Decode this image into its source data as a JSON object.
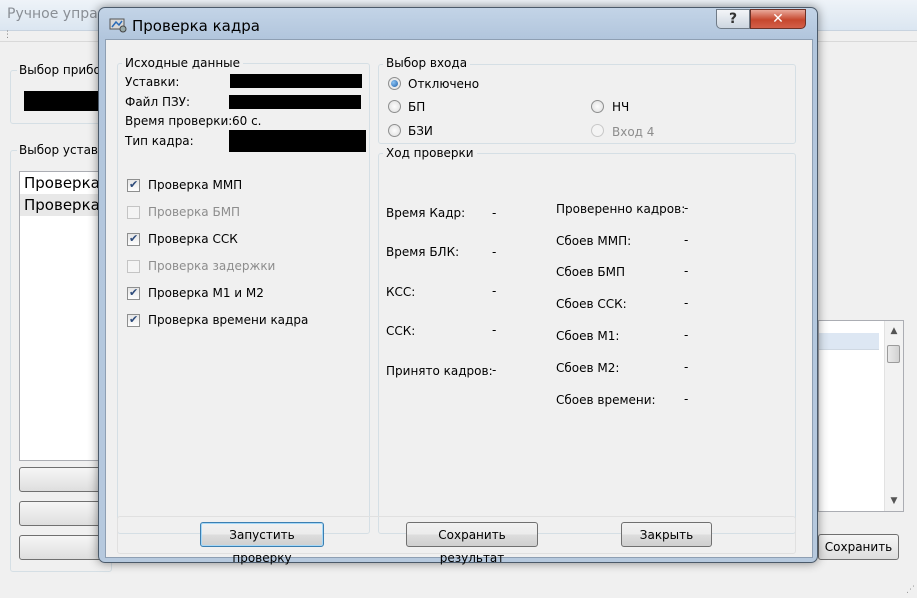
{
  "background": {
    "title": "Ручное упра",
    "device_group_label": "Выбор прибо",
    "setpoints_group_label": "Выбор уставо",
    "list_items": [
      "Проверка",
      "Проверка"
    ],
    "save_button_label": "Сохранить"
  },
  "dialog": {
    "title": "Проверка кадра",
    "help_label": "?",
    "close_label": "✕",
    "source": {
      "group_label": "Исходные данные",
      "setpoints_label": "Уставки:",
      "rom_file_label": "Файл ПЗУ:",
      "check_time_label": "Время проверки:",
      "check_time_value": "60 с.",
      "frame_type_label": "Тип кадра:"
    },
    "checks": [
      {
        "label": "Проверка ММП",
        "checked": true,
        "enabled": true
      },
      {
        "label": "Проверка БМП",
        "checked": false,
        "enabled": false
      },
      {
        "label": "Проверка ССК",
        "checked": true,
        "enabled": true
      },
      {
        "label": "Проверка задержки",
        "checked": false,
        "enabled": false
      },
      {
        "label": "Проверка М1 и М2",
        "checked": true,
        "enabled": true
      },
      {
        "label": "Проверка времени кадра",
        "checked": true,
        "enabled": true
      }
    ],
    "input": {
      "group_label": "Выбор входа",
      "options": [
        {
          "label": "Отключено",
          "selected": true,
          "enabled": true
        },
        {
          "label": "БП",
          "selected": false,
          "enabled": true
        },
        {
          "label": "НЧ",
          "selected": false,
          "enabled": true
        },
        {
          "label": "БЗИ",
          "selected": false,
          "enabled": true
        },
        {
          "label": "Вход 4",
          "selected": false,
          "enabled": false
        }
      ]
    },
    "progress": {
      "group_label": "Ход проверки",
      "left": [
        {
          "label": "Время Кадр:",
          "value": "-"
        },
        {
          "label": "Время БЛК:",
          "value": "-"
        },
        {
          "label": "КСС:",
          "value": "-"
        },
        {
          "label": "ССК:",
          "value": "-"
        },
        {
          "label": "Принято кадров:",
          "value": "-"
        }
      ],
      "right": [
        {
          "label": "Проверенно кадров:",
          "value": "-"
        },
        {
          "label": "Сбоев ММП:",
          "value": "-"
        },
        {
          "label": "Сбоев БМП",
          "value": "-"
        },
        {
          "label": "Сбоев ССК:",
          "value": "-"
        },
        {
          "label": "Сбоев М1:",
          "value": "-"
        },
        {
          "label": "Сбоев М2:",
          "value": "-"
        },
        {
          "label": "Сбоев времени:",
          "value": "-"
        }
      ]
    },
    "buttons": {
      "start": "Запустить проверку",
      "save": "Сохранить результат",
      "close": "Закрыть"
    }
  }
}
